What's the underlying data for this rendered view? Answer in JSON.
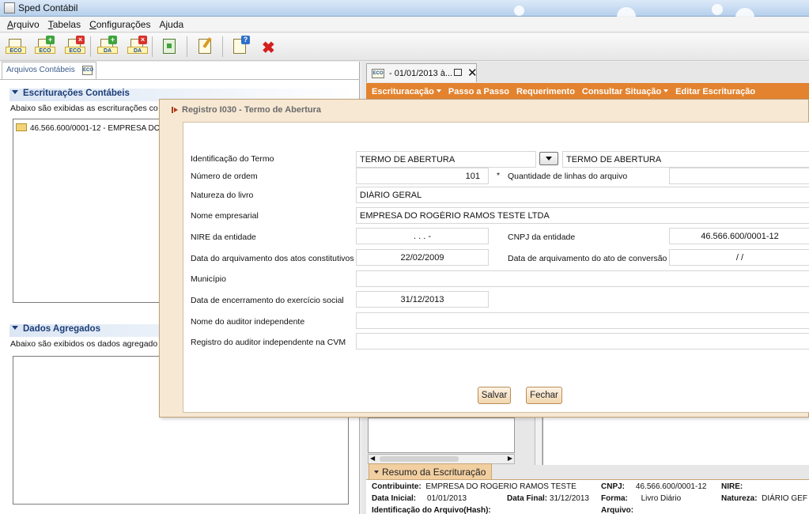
{
  "window": {
    "title": "Sped Contábil"
  },
  "menubar": {
    "items": [
      {
        "hotkey": "A",
        "rest": "rquivo"
      },
      {
        "hotkey": "T",
        "rest": "abelas"
      },
      {
        "hotkey": "C",
        "rest": "onfigurações"
      },
      {
        "hotkey": "",
        "rest": "Ajuda"
      }
    ]
  },
  "toolbar": {
    "buttons": [
      {
        "name": "open-eco-icon",
        "label": "ECO",
        "badge": ""
      },
      {
        "name": "new-eco-icon",
        "label": "ECO",
        "badge": "+"
      },
      {
        "name": "delete-eco-icon",
        "label": "ECO",
        "badge": "×"
      },
      {
        "name": "new-da-icon",
        "label": "DA",
        "badge": "+"
      },
      {
        "name": "delete-da-icon",
        "label": "DA",
        "badge": "×"
      },
      {
        "name": "export-icon",
        "label": "",
        "badge": ""
      },
      {
        "name": "edit-icon",
        "label": "",
        "badge": ""
      },
      {
        "name": "help-icon",
        "label": "",
        "badge": "?"
      },
      {
        "name": "close-icon",
        "label": "",
        "badge": ""
      }
    ]
  },
  "left_panel": {
    "tab_label": "Arquivos Contábeis",
    "tab_icon": "ECO",
    "escrituracoes": {
      "title": "Escriturações Contábeis",
      "description": "Abaixo são exibidas as escriturações co",
      "items": [
        "46.566.600/0001-12 - EMPRESA DO"
      ]
    },
    "dados": {
      "title": "Dados Agregados",
      "description": "Abaixo são exibidos os dados agregado"
    }
  },
  "right_panel": {
    "tab_label": "- 01/01/2013 à...",
    "menu": [
      {
        "label": "Escrituracação",
        "has_caret": true
      },
      {
        "label": "Passo a Passo",
        "has_caret": false
      },
      {
        "label": "Requerimento",
        "has_caret": false
      },
      {
        "label": "Consultar Situação",
        "has_caret": true
      },
      {
        "label": "Editar Escrituração",
        "has_caret": false
      }
    ],
    "resumo": {
      "tab_label": "Resumo da Escrituração",
      "contribuinte_label": "Contribuinte:",
      "contribuinte": "EMPRESA DO ROGERIO RAMOS TESTE",
      "cnpj_label": "CNPJ:",
      "cnpj": "46.566.600/0001-12",
      "nire_label": "NIRE:",
      "data_inicial_label": "Data Inicial:",
      "data_inicial": "01/01/2013",
      "data_final_label": "Data Final:",
      "data_final": "31/12/2013",
      "forma_label": "Forma:",
      "forma": "Livro Diário",
      "natureza_label": "Natureza:",
      "natureza": "DIÁRIO GEF",
      "hash_label": "Identificação do Arquivo(Hash):",
      "arquivo_label": "Arquivo:"
    }
  },
  "dialog": {
    "title": "Registro I030 - Termo de Abertura",
    "fields": {
      "identificacao": {
        "label": "Identificação do Termo",
        "value": "TERMO DE ABERTURA",
        "select_value": "TERMO DE ABERTURA"
      },
      "numero_ordem": {
        "label": "Número de ordem",
        "value": "101",
        "required_mark": "*"
      },
      "qtd_linhas": {
        "label": "Quantidade de linhas do arquivo",
        "value": ""
      },
      "natureza": {
        "label": "Natureza do livro",
        "value": "DIÁRIO GERAL"
      },
      "nome_empresarial": {
        "label": "Nome empresarial",
        "value": "EMPRESA DO ROGÉRIO RAMOS TESTE LTDA"
      },
      "nire": {
        "label": "NIRE da entidade",
        "value": ". . . -"
      },
      "cnpj": {
        "label": "CNPJ da entidade",
        "value": "46.566.600/0001-12"
      },
      "data_arquivamento": {
        "label": "Data do arquivamento dos atos constitutivos",
        "value": "22/02/2009"
      },
      "data_conversao": {
        "label": "Data de arquivamento do ato de conversão",
        "value": "/ /"
      },
      "municipio": {
        "label": "Município",
        "value": ""
      },
      "data_encerramento": {
        "label": "Data de encerramento do exercício social",
        "value": "31/12/2013"
      },
      "auditor": {
        "label": "Nome do auditor independente",
        "value": ""
      },
      "registro_auditor": {
        "label": "Registro do auditor independente na CVM",
        "value": ""
      }
    },
    "buttons": {
      "salvar": "Salvar",
      "fechar": "Fechar"
    }
  },
  "colors": {
    "accent_orange": "#e3832f",
    "dialog_bg": "#f7e8d4",
    "section_title": "#1c3d77"
  }
}
